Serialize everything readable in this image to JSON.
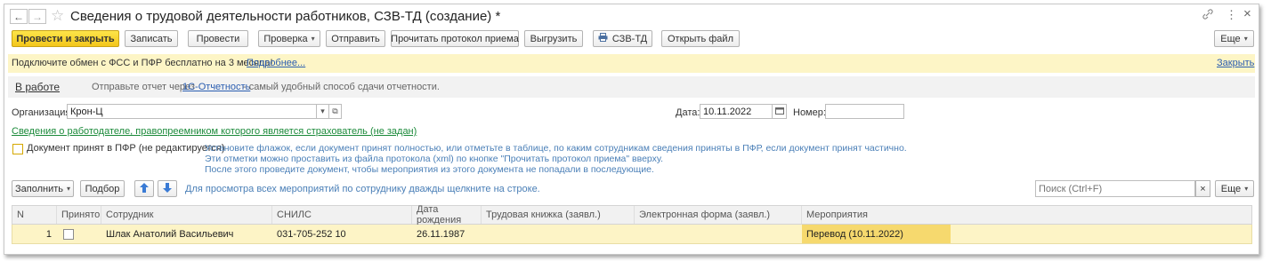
{
  "window": {
    "title": "Сведения о трудовой деятельности работников, СЗВ-ТД (создание) *",
    "link_icon": "link-icon",
    "more_icon": "⋮",
    "close_icon": "×"
  },
  "toolbar": {
    "post_close": "Провести и закрыть",
    "save": "Записать",
    "post": "Провести",
    "check": "Проверка",
    "send": "Отправить",
    "read_protocol": "Прочитать протокол приема",
    "export": "Выгрузить",
    "print_szv": "СЗВ-ТД",
    "open_file": "Открыть файл",
    "more": "Еще"
  },
  "banner": {
    "text": "Подключите обмен с ФСС и ПФР бесплатно на 3 месяца!",
    "link": "Подробнее...",
    "close": "Закрыть"
  },
  "status": {
    "label": "В работе",
    "text_before": "Отправьте отчет через",
    "link": "1С-Отчетность",
    "text_after": "- самый удобный способ сдачи отчетности."
  },
  "form": {
    "org_label": "Организация:",
    "org_value": "Крон-Ц",
    "date_label": "Дата:",
    "date_value": "10.11.2022",
    "number_label": "Номер:",
    "number_value": "",
    "successor_link": "Сведения о работодателе, правопреемником которого является страхователь (не задан)",
    "accepted_label": "Документ принят в ПФР (не редактируется)",
    "hint_lines": [
      "Установите флажок, если документ принят полностью, или отметьте в таблице, по каким сотрудникам сведения приняты в ПФР, если документ принят частично.",
      "Эти отметки можно проставить из файла протокола (xml) по кнопке \"Прочитать протокол приема\" вверху.",
      "После этого проведите документ, чтобы мероприятия из этого документа не попадали в последующие."
    ]
  },
  "table_toolbar": {
    "fill": "Заполнить",
    "select": "Подбор",
    "hint": "Для просмотра всех мероприятий по сотруднику дважды щелкните на строке.",
    "search_placeholder": "Поиск (Ctrl+F)",
    "clear": "×",
    "more": "Еще"
  },
  "table": {
    "columns": [
      "N",
      "Принято",
      "Сотрудник",
      "СНИЛС",
      "Дата рождения",
      "Трудовая книжка (заявл.)",
      "Электронная форма (заявл.)",
      "Мероприятия"
    ],
    "rows": [
      {
        "n": "1",
        "employee": "Шлак Анатолий Васильевич",
        "snils": "031-705-252 10",
        "birth": "26.11.1987",
        "paper": "",
        "electronic": "",
        "events": "Перевод (10.11.2022)"
      }
    ]
  },
  "colors": {
    "primary_button": "#f3c61a",
    "banner_bg": "#fdf5c6",
    "link": "#2a5db0",
    "green_link": "#1b8a3a",
    "hint": "#4a7fb7",
    "row_selected": "#fdf4c6"
  }
}
